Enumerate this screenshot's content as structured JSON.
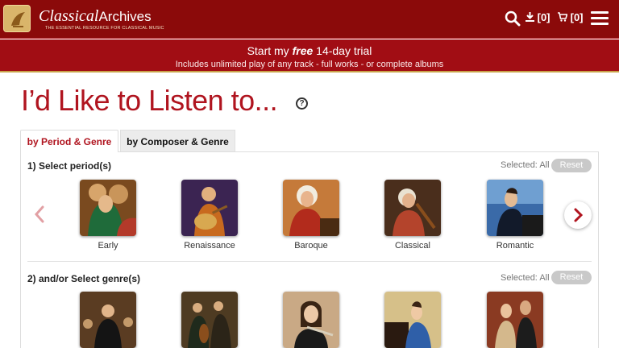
{
  "header": {
    "logo_word1": "Classical",
    "logo_word2": "Archives",
    "logo_tagline": "THE ESSENTIAL RESOURCE FOR CLASSICAL MUSIC",
    "download_count": "[0]",
    "cart_count": "[0]",
    "icons": [
      "logo-icon",
      "search-icon",
      "download-icon",
      "cart-icon",
      "menu-icon"
    ]
  },
  "trial": {
    "line1_prefix": "Start my ",
    "line1_emph": "free",
    "line1_suffix": " 14-day trial",
    "line2": "Includes unlimited play of any track - full works - or complete albums"
  },
  "page": {
    "title": "I’d Like to Listen to...",
    "help_label": "?"
  },
  "tabs": [
    {
      "label": "by Period & Genre",
      "active": true
    },
    {
      "label": "by Composer & Genre",
      "active": false
    }
  ],
  "periods": {
    "label": "1) Select period(s)",
    "selected_text": "Selected: All",
    "reset_label": "Reset",
    "items": [
      {
        "label": "Early"
      },
      {
        "label": "Renaissance"
      },
      {
        "label": "Baroque"
      },
      {
        "label": "Classical"
      },
      {
        "label": "Romantic"
      }
    ]
  },
  "genres": {
    "label": "2) and/or Select genre(s)",
    "selected_text": "Selected: All",
    "reset_label": "Reset",
    "items": [
      {
        "icon": "orchestral-painting"
      },
      {
        "icon": "chamber-painting"
      },
      {
        "icon": "solo-instrument-painting"
      },
      {
        "icon": "keyboard-painting"
      },
      {
        "icon": "vocal-painting"
      }
    ]
  },
  "colors": {
    "header_bg": "#8b0a0a",
    "banner_bg": "#a10d14",
    "accent_red": "#b0141f",
    "gold": "#c8a24a"
  }
}
